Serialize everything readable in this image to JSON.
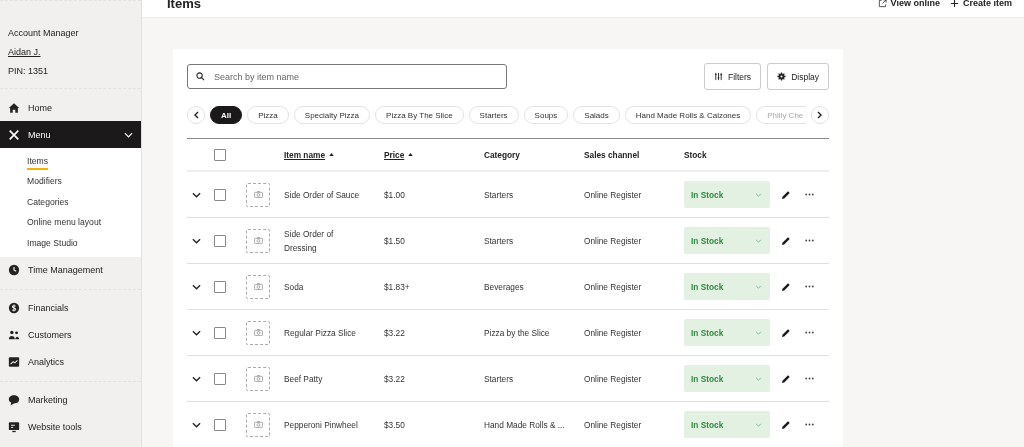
{
  "sidebar": {
    "account": {
      "role": "Account Manager",
      "name": "Aidan J.",
      "pin": "PIN: 1351"
    },
    "groups": [
      {
        "items": [
          {
            "label": "Home",
            "selected": false
          },
          {
            "label": "Menu",
            "selected": true,
            "expanded": true,
            "children": [
              {
                "label": "Items",
                "selected": true
              },
              {
                "label": "Modifiers",
                "selected": false
              },
              {
                "label": "Categories",
                "selected": false
              },
              {
                "label": "Online menu layout",
                "selected": false
              },
              {
                "label": "Image Studio",
                "selected": false
              }
            ]
          },
          {
            "label": "Time Management",
            "selected": false
          }
        ]
      },
      {
        "items": [
          {
            "label": "Financials",
            "selected": false
          },
          {
            "label": "Customers",
            "selected": false
          },
          {
            "label": "Analytics",
            "selected": false
          }
        ]
      },
      {
        "items": [
          {
            "label": "Marketing",
            "selected": false
          },
          {
            "label": "Website tools",
            "selected": false
          }
        ]
      }
    ]
  },
  "header": {
    "title": "Items",
    "actions": [
      "View online",
      "Create item"
    ]
  },
  "search": {
    "placeholder": "Search by item name"
  },
  "buttons": [
    "Filters",
    "Display"
  ],
  "chips": [
    {
      "label": "All",
      "selected": true
    },
    {
      "label": "Pizza",
      "selected": false
    },
    {
      "label": "Specialty Pizza",
      "selected": false
    },
    {
      "label": "Pizza By The Slice",
      "selected": false
    },
    {
      "label": "Starters",
      "selected": false
    },
    {
      "label": "Soups",
      "selected": false
    },
    {
      "label": "Salads",
      "selected": false
    },
    {
      "label": "Hand Made Rolls & Calzones",
      "selected": false
    },
    {
      "label": "Philly Che",
      "selected": false
    }
  ],
  "table": {
    "select_all": {
      "checked": false
    },
    "columns": [
      {
        "label": "Item name",
        "sortable": true
      },
      {
        "label": "Price",
        "sortable": true
      },
      {
        "label": "Category",
        "sortable": false
      },
      {
        "label": "Sales channel",
        "sortable": false
      },
      {
        "label": "Stock",
        "sortable": false
      }
    ],
    "rows": [
      {
        "name": "Side Order of Sauce",
        "price": "$1.00",
        "category": "Starters",
        "channel": "Online Register",
        "stock": "In Stock",
        "checked": false
      },
      {
        "name": "Side Order of Dressing",
        "price": "$1.50",
        "category": "Starters",
        "channel": "Online Register",
        "stock": "In Stock",
        "checked": false
      },
      {
        "name": "Soda",
        "price": "$1.83+",
        "category": "Beverages",
        "channel": "Online Register",
        "stock": "In Stock",
        "checked": false
      },
      {
        "name": "Regular Pizza Slice",
        "price": "$3.22",
        "category": "Pizza by the Slice",
        "channel": "Online Register",
        "stock": "In Stock",
        "checked": false
      },
      {
        "name": "Beef Patty",
        "price": "$3.22",
        "category": "Starters",
        "channel": "Online Register",
        "stock": "In Stock",
        "checked": false
      },
      {
        "name": "Pepperoni Pinwheel",
        "price": "$3.50",
        "category": "Hand Made Rolls & ...",
        "channel": "Online Register",
        "stock": "In Stock",
        "checked": false
      }
    ]
  }
}
